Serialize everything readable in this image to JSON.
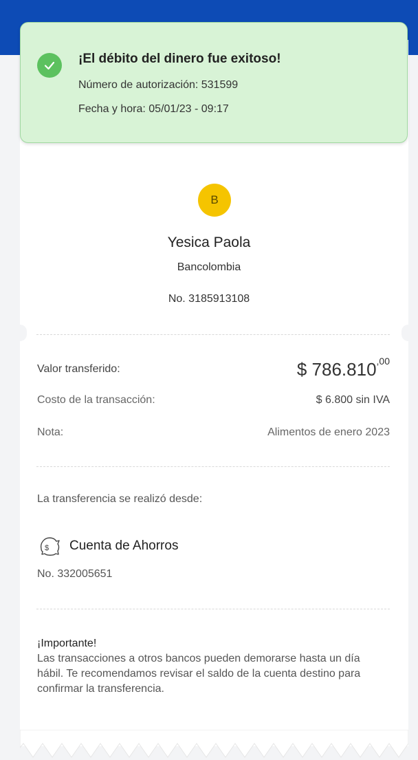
{
  "toast": {
    "title": "¡El débito del dinero fue exitoso!",
    "auth": "Número de autorización: 531599",
    "datetime": "Fecha y hora: 05/01/23 - 09:17",
    "color": "#d8f3d6"
  },
  "recipient": {
    "initial": "B",
    "name": "Yesica Paola",
    "bank": "Bancolombia",
    "number": "No. 3185913108"
  },
  "details": {
    "amount_label": "Valor transferido:",
    "amount_main": "$ 786.810",
    "amount_cents": ",00",
    "cost_label": "Costo de la transacción:",
    "cost_value": "$ 6.800 sin IVA",
    "note_label": "Nota:",
    "note_value": "Alimentos de enero 2023"
  },
  "source": {
    "label": "La transferencia se realizó desde:",
    "account_type": "Cuenta de Ahorros",
    "account_number": "No. 332005651",
    "icon": "piggy-bank-icon"
  },
  "important": {
    "title": "¡Importante!",
    "text": "Las transacciones a otros bancos pueden demorarse hasta un día hábil. Te recomendamos revisar el saldo de la cuenta destino para confirmar la transferencia."
  }
}
